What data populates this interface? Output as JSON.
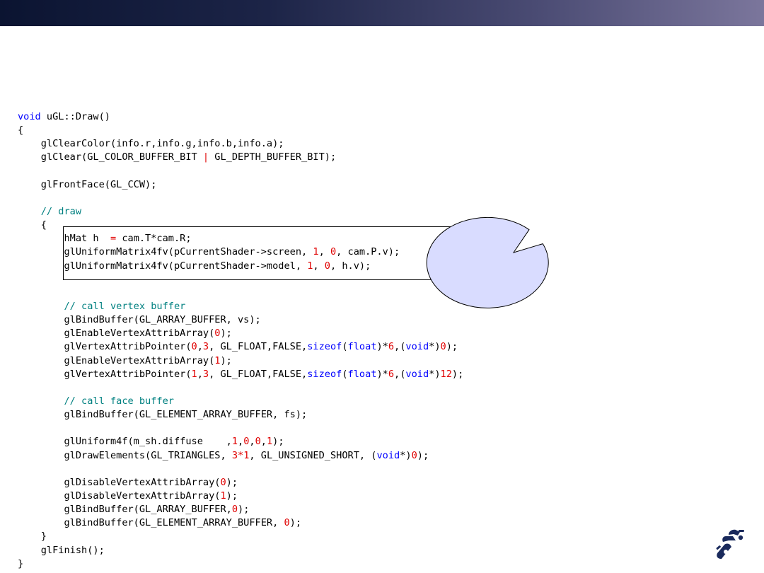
{
  "header": {
    "bar_gradient": [
      "#0b1431",
      "#7b769c"
    ]
  },
  "colors": {
    "keyword": "#0000ff",
    "number": "#e00000",
    "comment": "#008080",
    "text": "#000000"
  },
  "code": {
    "language": "cpp",
    "lines": [
      [
        {
          "t": "void",
          "c": "kw"
        },
        {
          "t": " uGL::Draw()",
          "c": "text"
        }
      ],
      [
        {
          "t": "{",
          "c": "text"
        }
      ],
      [
        {
          "t": "    glClearColor(info.r,info.g,info.b,info.a);",
          "c": "text"
        }
      ],
      [
        {
          "t": "    glClear(GL_COLOR_BUFFER_BIT ",
          "c": "text"
        },
        {
          "t": "|",
          "c": "num"
        },
        {
          "t": " GL_DEPTH_BUFFER_BIT);",
          "c": "text"
        }
      ],
      [],
      [
        {
          "t": "    glFrontFace(GL_CCW);",
          "c": "text"
        }
      ],
      [],
      [
        {
          "t": "    // draw",
          "c": "cmt"
        }
      ],
      [
        {
          "t": "    {",
          "c": "text"
        }
      ],
      [
        {
          "t": "        hMat h  ",
          "c": "text"
        },
        {
          "t": "=",
          "c": "num"
        },
        {
          "t": " cam.T*cam.R;",
          "c": "text"
        }
      ],
      [
        {
          "t": "        glUniformMatrix4fv(pCurrentShader->screen, ",
          "c": "text"
        },
        {
          "t": "1",
          "c": "num"
        },
        {
          "t": ", ",
          "c": "text"
        },
        {
          "t": "0",
          "c": "num"
        },
        {
          "t": ", cam.P.v);",
          "c": "text"
        }
      ],
      [
        {
          "t": "        glUniformMatrix4fv(pCurrentShader->model, ",
          "c": "text"
        },
        {
          "t": "1",
          "c": "num"
        },
        {
          "t": ", ",
          "c": "text"
        },
        {
          "t": "0",
          "c": "num"
        },
        {
          "t": ", h.v);",
          "c": "text"
        }
      ],
      [],
      [],
      [
        {
          "t": "        // call vertex buffer",
          "c": "cmt"
        }
      ],
      [
        {
          "t": "        glBindBuffer(GL_ARRAY_BUFFER, vs);",
          "c": "text"
        }
      ],
      [
        {
          "t": "        glEnableVertexAttribArray(",
          "c": "text"
        },
        {
          "t": "0",
          "c": "num"
        },
        {
          "t": ");",
          "c": "text"
        }
      ],
      [
        {
          "t": "        glVertexAttribPointer(",
          "c": "text"
        },
        {
          "t": "0",
          "c": "num"
        },
        {
          "t": ",",
          "c": "text"
        },
        {
          "t": "3",
          "c": "num"
        },
        {
          "t": ", GL_FLOAT,FALSE,",
          "c": "text"
        },
        {
          "t": "sizeof",
          "c": "kw"
        },
        {
          "t": "(",
          "c": "text"
        },
        {
          "t": "float",
          "c": "kw"
        },
        {
          "t": ")*",
          "c": "text"
        },
        {
          "t": "6",
          "c": "num"
        },
        {
          "t": ",(",
          "c": "text"
        },
        {
          "t": "void",
          "c": "kw"
        },
        {
          "t": "*)",
          "c": "text"
        },
        {
          "t": "0",
          "c": "num"
        },
        {
          "t": ");",
          "c": "text"
        }
      ],
      [
        {
          "t": "        glEnableVertexAttribArray(",
          "c": "text"
        },
        {
          "t": "1",
          "c": "num"
        },
        {
          "t": ");",
          "c": "text"
        }
      ],
      [
        {
          "t": "        glVertexAttribPointer(",
          "c": "text"
        },
        {
          "t": "1",
          "c": "num"
        },
        {
          "t": ",",
          "c": "text"
        },
        {
          "t": "3",
          "c": "num"
        },
        {
          "t": ", GL_FLOAT,FALSE,",
          "c": "text"
        },
        {
          "t": "sizeof",
          "c": "kw"
        },
        {
          "t": "(",
          "c": "text"
        },
        {
          "t": "float",
          "c": "kw"
        },
        {
          "t": ")*",
          "c": "text"
        },
        {
          "t": "6",
          "c": "num"
        },
        {
          "t": ",(",
          "c": "text"
        },
        {
          "t": "void",
          "c": "kw"
        },
        {
          "t": "*)",
          "c": "text"
        },
        {
          "t": "12",
          "c": "num"
        },
        {
          "t": ");",
          "c": "text"
        }
      ],
      [],
      [
        {
          "t": "        // call face buffer",
          "c": "cmt"
        }
      ],
      [
        {
          "t": "        glBindBuffer(GL_ELEMENT_ARRAY_BUFFER, fs);",
          "c": "text"
        }
      ],
      [],
      [
        {
          "t": "        glUniform4f(m_sh.diffuse    ,",
          "c": "text"
        },
        {
          "t": "1",
          "c": "num"
        },
        {
          "t": ",",
          "c": "text"
        },
        {
          "t": "0",
          "c": "num"
        },
        {
          "t": ",",
          "c": "text"
        },
        {
          "t": "0",
          "c": "num"
        },
        {
          "t": ",",
          "c": "text"
        },
        {
          "t": "1",
          "c": "num"
        },
        {
          "t": ");",
          "c": "text"
        }
      ],
      [
        {
          "t": "        glDrawElements(GL_TRIANGLES, ",
          "c": "text"
        },
        {
          "t": "3*1",
          "c": "num"
        },
        {
          "t": ", GL_UNSIGNED_SHORT, (",
          "c": "text"
        },
        {
          "t": "void",
          "c": "kw"
        },
        {
          "t": "*)",
          "c": "text"
        },
        {
          "t": "0",
          "c": "num"
        },
        {
          "t": ");",
          "c": "text"
        }
      ],
      [],
      [
        {
          "t": "        glDisableVertexAttribArray(",
          "c": "text"
        },
        {
          "t": "0",
          "c": "num"
        },
        {
          "t": ");",
          "c": "text"
        }
      ],
      [
        {
          "t": "        glDisableVertexAttribArray(",
          "c": "text"
        },
        {
          "t": "1",
          "c": "num"
        },
        {
          "t": ");",
          "c": "text"
        }
      ],
      [
        {
          "t": "        glBindBuffer(GL_ARRAY_BUFFER,",
          "c": "text"
        },
        {
          "t": "0",
          "c": "num"
        },
        {
          "t": ");",
          "c": "text"
        }
      ],
      [
        {
          "t": "        glBindBuffer(GL_ELEMENT_ARRAY_BUFFER, ",
          "c": "text"
        },
        {
          "t": "0",
          "c": "num"
        },
        {
          "t": ");",
          "c": "text"
        }
      ],
      [
        {
          "t": "    }",
          "c": "text"
        }
      ],
      [
        {
          "t": "    glFinish();",
          "c": "text"
        }
      ],
      [
        {
          "t": "}",
          "c": "text"
        }
      ]
    ]
  },
  "callout": {
    "fill": "#d9dcff",
    "stroke": "#000000"
  },
  "logo": {
    "icon": "robot-arm-logo-icon",
    "color": "#1a2a5c"
  }
}
